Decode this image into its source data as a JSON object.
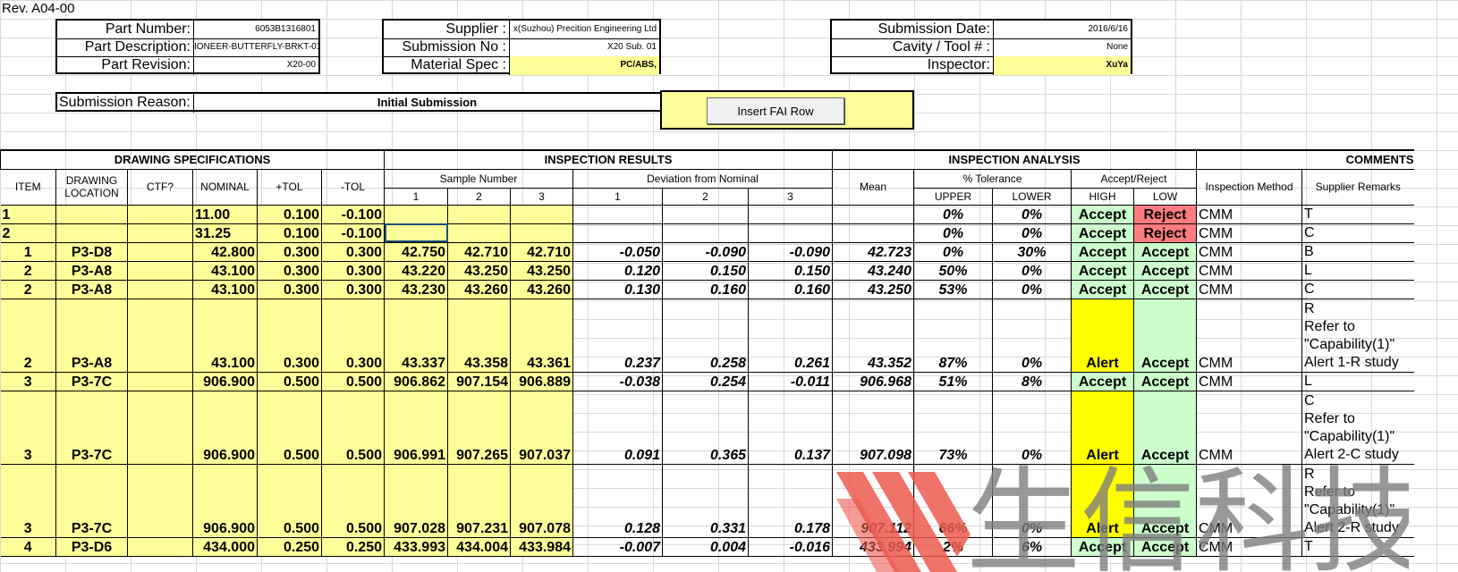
{
  "revision": "Rev. A04-00",
  "header": {
    "part_number_label": "Part Number:",
    "part_number": "6053B1316801",
    "part_description_label": "Part Description:",
    "part_description": "IONEER-BUTTERFLY-BRKT-01",
    "part_revision_label": "Part Revision:",
    "part_revision": "X20-00",
    "supplier_label": "Supplier :",
    "supplier": "x(Suzhou) Precition Engineering Ltd",
    "submission_no_label": "Submission No :",
    "submission_no": "X20 Sub. 01",
    "material_spec_label": "Material Spec :",
    "material_spec": "PC/ABS,",
    "submission_date_label": "Submission Date:",
    "submission_date": "2016/6/16",
    "cavity_label": "Cavity / Tool # :",
    "cavity": "None",
    "inspector_label": "Inspector:",
    "inspector": "XuYa",
    "reason_label": "Submission Reason:",
    "reason": "Initial Submission"
  },
  "button": {
    "insert_fai_row": "Insert FAI Row"
  },
  "sections": {
    "drawing_specs": "DRAWING SPECIFICATIONS",
    "inspection_results": "INSPECTION RESULTS",
    "inspection_analysis": "INSPECTION ANALYSIS",
    "comments": "COMMENTS"
  },
  "columns": {
    "item": "ITEM",
    "drawing_location_1": "DRAWING",
    "drawing_location_2": "LOCATION",
    "ctf": "CTF?",
    "nominal": "NOMINAL",
    "plus_tol": "+TOL",
    "minus_tol": "-TOL",
    "sample_number": "Sample Number",
    "deviation": "Deviation from Nominal",
    "n1": "1",
    "n2": "2",
    "n3": "3",
    "mean": "Mean",
    "pct_tolerance": "% Tolerance",
    "upper": "UPPER",
    "lower": "LOWER",
    "accept_reject": "Accept/Reject",
    "high": "HIGH",
    "low": "LOW",
    "inspection_method": "Inspection Method",
    "supplier_remarks": "Supplier Remarks"
  },
  "rows": [
    {
      "item": "1",
      "loc": "",
      "nominal": "11.00",
      "ptol": "0.100",
      "mtol": "-0.100",
      "s": [
        "",
        "",
        ""
      ],
      "d": [
        "",
        "",
        ""
      ],
      "mean": "",
      "upper": "0%",
      "lower": "0%",
      "high": "Accept",
      "low": "Reject",
      "method": "CMM",
      "remarks": [
        "T"
      ]
    },
    {
      "item": "2",
      "loc": "",
      "nominal": "31.25",
      "ptol": "0.100",
      "mtol": "-0.100",
      "s": [
        "",
        "",
        ""
      ],
      "d": [
        "",
        "",
        ""
      ],
      "mean": "",
      "upper": "0%",
      "lower": "0%",
      "high": "Accept",
      "low": "Reject",
      "method": "CMM",
      "remarks": [
        "C"
      ]
    },
    {
      "item": "1",
      "loc": "P3-D8",
      "nominal": "42.800",
      "ptol": "0.300",
      "mtol": "0.300",
      "s": [
        "42.750",
        "42.710",
        "42.710"
      ],
      "d": [
        "-0.050",
        "-0.090",
        "-0.090"
      ],
      "mean": "42.723",
      "upper": "0%",
      "lower": "30%",
      "high": "Accept",
      "low": "Accept",
      "method": "CMM",
      "remarks": [
        "B"
      ]
    },
    {
      "item": "2",
      "loc": "P3-A8",
      "nominal": "43.100",
      "ptol": "0.300",
      "mtol": "0.300",
      "s": [
        "43.220",
        "43.250",
        "43.250"
      ],
      "d": [
        "0.120",
        "0.150",
        "0.150"
      ],
      "mean": "43.240",
      "upper": "50%",
      "lower": "0%",
      "high": "Accept",
      "low": "Accept",
      "method": "CMM",
      "remarks": [
        "L"
      ]
    },
    {
      "item": "2",
      "loc": "P3-A8",
      "nominal": "43.100",
      "ptol": "0.300",
      "mtol": "0.300",
      "s": [
        "43.230",
        "43.260",
        "43.260"
      ],
      "d": [
        "0.130",
        "0.160",
        "0.160"
      ],
      "mean": "43.250",
      "upper": "53%",
      "lower": "0%",
      "high": "Accept",
      "low": "Accept",
      "method": "CMM",
      "remarks": [
        "C"
      ]
    },
    {
      "item": "2",
      "loc": "P3-A8",
      "nominal": "43.100",
      "ptol": "0.300",
      "mtol": "0.300",
      "s": [
        "43.337",
        "43.358",
        "43.361"
      ],
      "d": [
        "0.237",
        "0.258",
        "0.261"
      ],
      "mean": "43.352",
      "upper": "87%",
      "lower": "0%",
      "high": "Alert",
      "low": "Accept",
      "method": "CMM",
      "remarks": [
        "R",
        "Refer to",
        "\"Capability(1)\"",
        "Alert 1-R study"
      ]
    },
    {
      "item": "3",
      "loc": "P3-7C",
      "nominal": "906.900",
      "ptol": "0.500",
      "mtol": "0.500",
      "s": [
        "906.862",
        "907.154",
        "906.889"
      ],
      "d": [
        "-0.038",
        "0.254",
        "-0.011"
      ],
      "mean": "906.968",
      "upper": "51%",
      "lower": "8%",
      "high": "Accept",
      "low": "Accept",
      "method": "CMM",
      "remarks": [
        "L"
      ]
    },
    {
      "item": "3",
      "loc": "P3-7C",
      "nominal": "906.900",
      "ptol": "0.500",
      "mtol": "0.500",
      "s": [
        "906.991",
        "907.265",
        "907.037"
      ],
      "d": [
        "0.091",
        "0.365",
        "0.137"
      ],
      "mean": "907.098",
      "upper": "73%",
      "lower": "0%",
      "high": "Alert",
      "low": "Accept",
      "method": "CMM",
      "remarks": [
        "C",
        "Refer to",
        "\"Capability(1)\"",
        "Alert 2-C study"
      ]
    },
    {
      "item": "3",
      "loc": "P3-7C",
      "nominal": "906.900",
      "ptol": "0.500",
      "mtol": "0.500",
      "s": [
        "907.028",
        "907.231",
        "907.078"
      ],
      "d": [
        "0.128",
        "0.331",
        "0.178"
      ],
      "mean": "907.112",
      "upper": "66%",
      "lower": "0%",
      "high": "Alert",
      "low": "Accept",
      "method": "CMM",
      "remarks": [
        "R",
        "Refer to",
        "\"Capability(1)\"",
        "Alert 2-R study"
      ]
    },
    {
      "item": "4",
      "loc": "P3-D6",
      "nominal": "434.000",
      "ptol": "0.250",
      "mtol": "0.250",
      "s": [
        "433.993",
        "434.004",
        "433.984"
      ],
      "d": [
        "-0.007",
        "0.004",
        "-0.016"
      ],
      "mean": "433.994",
      "upper": "2%",
      "lower": "6%",
      "high": "Accept",
      "low": "Accept",
      "method": "CMM",
      "remarks": [
        "T"
      ]
    }
  ],
  "watermark": {
    "text": "生信科技"
  },
  "colors": {
    "input_yellow": "#ffff99",
    "alert_yellow": "#ffff00",
    "accept_green": "#ccffcc",
    "reject_red": "#ff7c80"
  }
}
